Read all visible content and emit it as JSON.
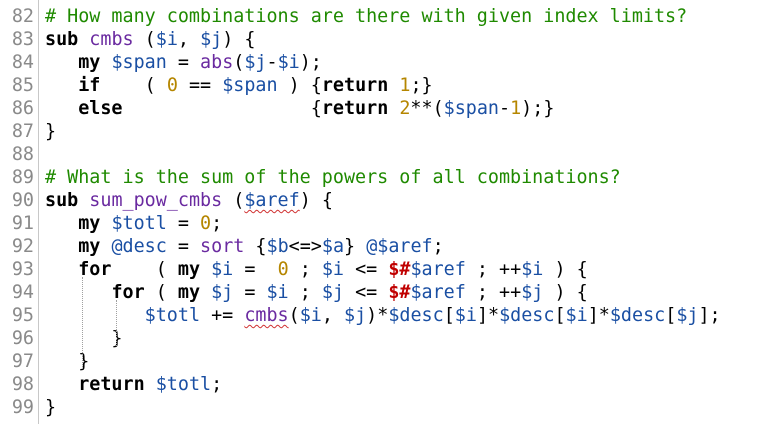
{
  "lines": [
    {
      "n": "82",
      "parts": [
        [
          "cmt",
          "# How many combinations are there with given index limits?"
        ]
      ]
    },
    {
      "n": "83",
      "parts": [
        [
          "kw",
          "sub"
        ],
        [
          "plain",
          " "
        ],
        [
          "fn",
          "cmbs"
        ],
        [
          "plain",
          " ("
        ],
        [
          "var",
          "$i"
        ],
        [
          "plain",
          ", "
        ],
        [
          "var",
          "$j"
        ],
        [
          "plain",
          ") {"
        ]
      ]
    },
    {
      "n": "84",
      "parts": [
        [
          "plain",
          "   "
        ],
        [
          "kw",
          "my"
        ],
        [
          "plain",
          " "
        ],
        [
          "var",
          "$span"
        ],
        [
          "plain",
          " = "
        ],
        [
          "fn",
          "abs"
        ],
        [
          "plain",
          "("
        ],
        [
          "var",
          "$j"
        ],
        [
          "plain",
          "-"
        ],
        [
          "var",
          "$i"
        ],
        [
          "plain",
          ");"
        ]
      ]
    },
    {
      "n": "85",
      "parts": [
        [
          "plain",
          "   "
        ],
        [
          "kw",
          "if"
        ],
        [
          "plain",
          "    ( "
        ],
        [
          "num",
          "0"
        ],
        [
          "plain",
          " == "
        ],
        [
          "var",
          "$span"
        ],
        [
          "plain",
          " ) {"
        ],
        [
          "kw",
          "return"
        ],
        [
          "plain",
          " "
        ],
        [
          "num",
          "1"
        ],
        [
          "plain",
          ";}"
        ]
      ]
    },
    {
      "n": "86",
      "parts": [
        [
          "plain",
          "   "
        ],
        [
          "kw",
          "else"
        ],
        [
          "plain",
          "                 {"
        ],
        [
          "kw",
          "return"
        ],
        [
          "plain",
          " "
        ],
        [
          "num",
          "2"
        ],
        [
          "plain",
          "**("
        ],
        [
          "var",
          "$span"
        ],
        [
          "plain",
          "-"
        ],
        [
          "num",
          "1"
        ],
        [
          "plain",
          ");}"
        ]
      ]
    },
    {
      "n": "87",
      "parts": [
        [
          "plain",
          "}"
        ]
      ]
    },
    {
      "n": "88",
      "parts": []
    },
    {
      "n": "89",
      "parts": [
        [
          "cmt",
          "# What is the sum of the powers of all combinations?"
        ]
      ]
    },
    {
      "n": "90",
      "parts": [
        [
          "kw",
          "sub"
        ],
        [
          "plain",
          " "
        ],
        [
          "fn",
          "sum_pow_cmbs"
        ],
        [
          "plain",
          " ("
        ],
        [
          "varsq",
          "$aref"
        ],
        [
          "plain",
          ") {"
        ]
      ]
    },
    {
      "n": "91",
      "parts": [
        [
          "plain",
          "   "
        ],
        [
          "kw",
          "my"
        ],
        [
          "plain",
          " "
        ],
        [
          "var",
          "$totl"
        ],
        [
          "plain",
          " = "
        ],
        [
          "num",
          "0"
        ],
        [
          "plain",
          ";"
        ]
      ]
    },
    {
      "n": "92",
      "parts": [
        [
          "plain",
          "   "
        ],
        [
          "kw",
          "my"
        ],
        [
          "plain",
          " "
        ],
        [
          "var",
          "@desc"
        ],
        [
          "plain",
          " = "
        ],
        [
          "fn",
          "sort"
        ],
        [
          "plain",
          " {"
        ],
        [
          "var",
          "$b"
        ],
        [
          "plain",
          "<=>"
        ],
        [
          "var",
          "$a"
        ],
        [
          "plain",
          "} "
        ],
        [
          "var",
          "@$aref"
        ],
        [
          "plain",
          ";"
        ]
      ]
    },
    {
      "n": "93",
      "parts": [
        [
          "plain",
          "   "
        ],
        [
          "kw",
          "for"
        ],
        [
          "plain",
          "    ( "
        ],
        [
          "kw",
          "my"
        ],
        [
          "plain",
          " "
        ],
        [
          "var",
          "$i"
        ],
        [
          "plain",
          " =  "
        ],
        [
          "num",
          "0"
        ],
        [
          "plain",
          " ; "
        ],
        [
          "var",
          "$i"
        ],
        [
          "plain",
          " <= "
        ],
        [
          "spc",
          "$#"
        ],
        [
          "var",
          "$aref"
        ],
        [
          "plain",
          " ; ++"
        ],
        [
          "var",
          "$i"
        ],
        [
          "plain",
          " ) {"
        ]
      ]
    },
    {
      "n": "94",
      "parts": [
        [
          "plain",
          "      "
        ],
        [
          "kw",
          "for"
        ],
        [
          "plain",
          " ( "
        ],
        [
          "kw",
          "my"
        ],
        [
          "plain",
          " "
        ],
        [
          "var",
          "$j"
        ],
        [
          "plain",
          " = "
        ],
        [
          "var",
          "$i"
        ],
        [
          "plain",
          " ; "
        ],
        [
          "var",
          "$j"
        ],
        [
          "plain",
          " <= "
        ],
        [
          "spc",
          "$#"
        ],
        [
          "var",
          "$aref"
        ],
        [
          "plain",
          " ; ++"
        ],
        [
          "var",
          "$j"
        ],
        [
          "plain",
          " ) {"
        ]
      ]
    },
    {
      "n": "95",
      "parts": [
        [
          "plain",
          "         "
        ],
        [
          "var",
          "$totl"
        ],
        [
          "plain",
          " += "
        ],
        [
          "sq",
          "cmbs"
        ],
        [
          "plain",
          "("
        ],
        [
          "var",
          "$i"
        ],
        [
          "plain",
          ", "
        ],
        [
          "var",
          "$j"
        ],
        [
          "plain",
          ")*"
        ],
        [
          "var",
          "$desc"
        ],
        [
          "plain",
          "["
        ],
        [
          "var",
          "$i"
        ],
        [
          "plain",
          "]*"
        ],
        [
          "var",
          "$desc"
        ],
        [
          "plain",
          "["
        ],
        [
          "var",
          "$i"
        ],
        [
          "plain",
          "]*"
        ],
        [
          "var",
          "$desc"
        ],
        [
          "plain",
          "["
        ],
        [
          "var",
          "$j"
        ],
        [
          "plain",
          "];"
        ]
      ]
    },
    {
      "n": "96",
      "parts": [
        [
          "plain",
          "      }"
        ]
      ]
    },
    {
      "n": "97",
      "parts": [
        [
          "plain",
          "   }"
        ]
      ]
    },
    {
      "n": "98",
      "parts": [
        [
          "plain",
          "   "
        ],
        [
          "kw",
          "return"
        ],
        [
          "plain",
          " "
        ],
        [
          "var",
          "$totl"
        ],
        [
          "plain",
          ";"
        ]
      ]
    },
    {
      "n": "99",
      "parts": [
        [
          "plain",
          "}"
        ]
      ]
    }
  ],
  "colors": {
    "keyword": "#000000",
    "variable": "#1a4fa3",
    "number": "#b58600",
    "comment": "#1f8a00",
    "function": "#6a2aa0",
    "special": "#c00000",
    "line_number": "#8a8a8a"
  },
  "icons": {
    "squiggle": "spellcheck-underline"
  }
}
